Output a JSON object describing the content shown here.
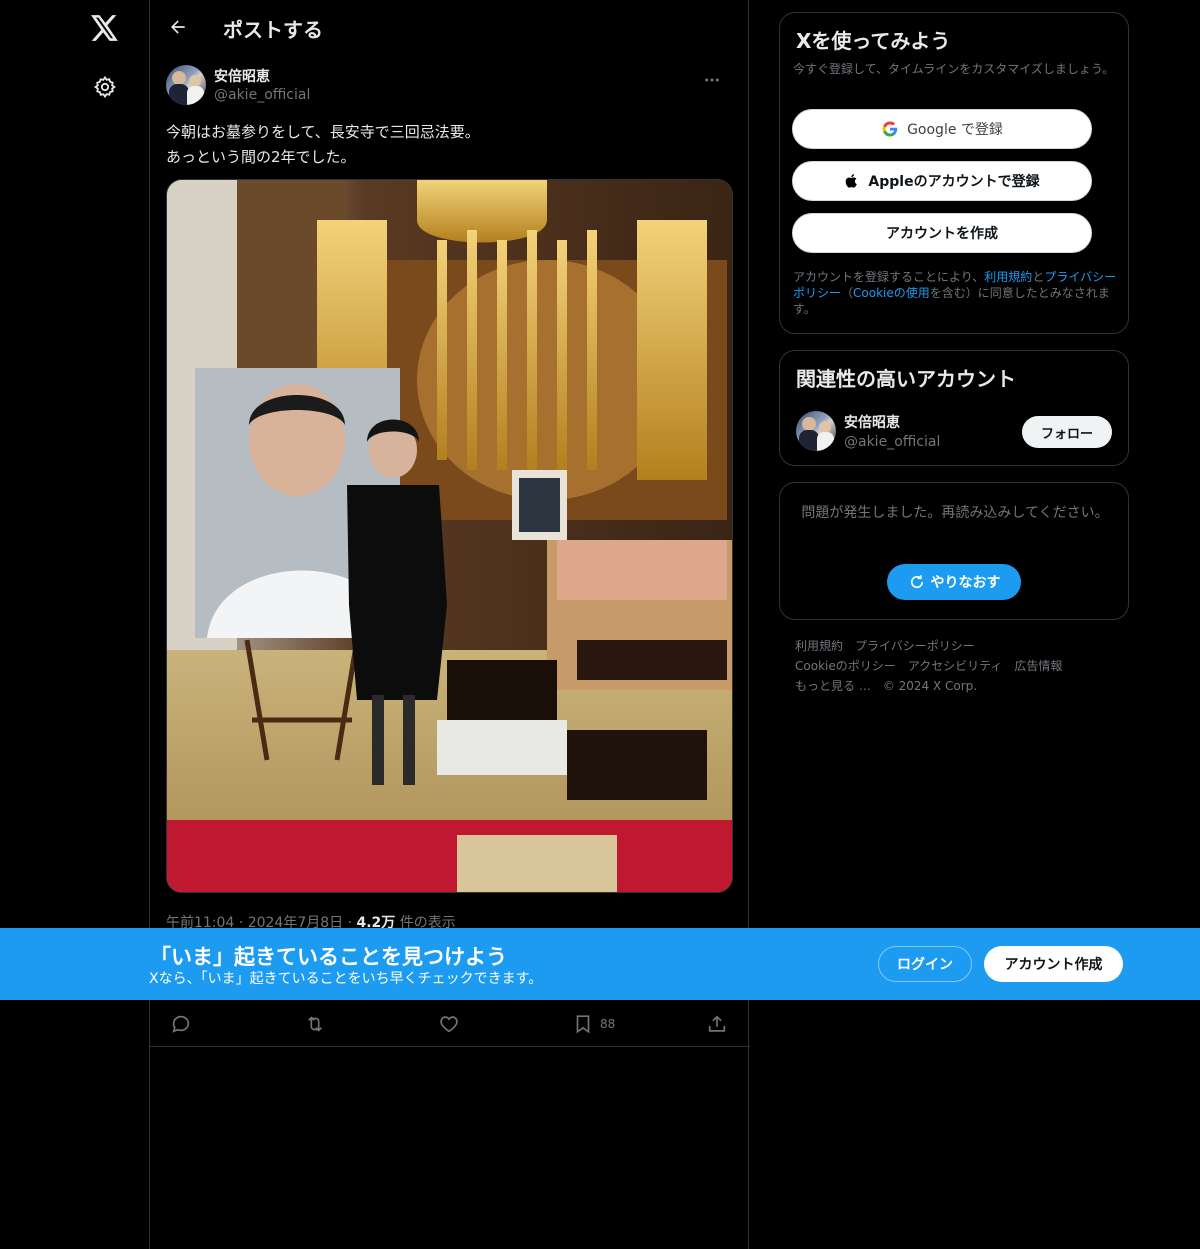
{
  "header": {
    "title": "ポストする"
  },
  "post": {
    "author_name": "安倍昭恵",
    "author_handle": "@akie_official",
    "text": "今朝はお墓参りをして、長安寺で三回忌法要。\nあっという間の2年でした。",
    "timestamp": "午前11:04 · 2024年7月8日 ·",
    "views_count": "4.2万",
    "views_label": "件の表示",
    "bookmark_count": "88"
  },
  "signup_card": {
    "title": "Xを使ってみよう",
    "subtitle": "今すぐ登録して、タイムラインをカスタマイズしましょう。",
    "google_label": "Google で登録",
    "apple_label": "Appleのアカウントで登録",
    "create_label": "アカウントを作成",
    "legal_prefix": "アカウントを登録することにより、",
    "legal_terms": "利用規約",
    "legal_and": "と",
    "legal_privacy": "プライバシーポリシー",
    "legal_mid": "（",
    "legal_cookie": "Cookieの使用",
    "legal_suffix": "を含む）に同意したとみなされます。"
  },
  "related_card": {
    "title": "関連性の高いアカウント",
    "name": "安倍昭恵",
    "handle": "@akie_official",
    "follow_label": "フォロー"
  },
  "error_card": {
    "message": "問題が発生しました。再読み込みしてください。",
    "retry_label": "やりなおす"
  },
  "footer": {
    "links": [
      "利用規約",
      "プライバシーポリシー",
      "Cookieのポリシー",
      "アクセシビリティ",
      "広告情報",
      "もっと見る …"
    ],
    "copyright": "© 2024 X Corp."
  },
  "banner": {
    "headline": "「いま」起きていることを見つけよう",
    "subline": "Xなら、「いま」起きていることをいち早くチェックできます。",
    "login_label": "ログイン",
    "signup_label": "アカウント作成"
  },
  "icons": {
    "logo": "x-logo-icon",
    "settings": "gear-icon",
    "back": "arrow-left-icon",
    "more": "more-dots-icon",
    "reply": "reply-icon",
    "repost": "repost-icon",
    "like": "heart-icon",
    "bookmark": "bookmark-icon",
    "share": "share-icon",
    "google": "google-icon",
    "apple": "apple-icon",
    "retry": "refresh-icon"
  },
  "colors": {
    "accent": "#1d9bf0",
    "background": "#000000",
    "text_primary": "#e7e9ea",
    "text_secondary": "#71767b",
    "border": "#2f3336"
  }
}
